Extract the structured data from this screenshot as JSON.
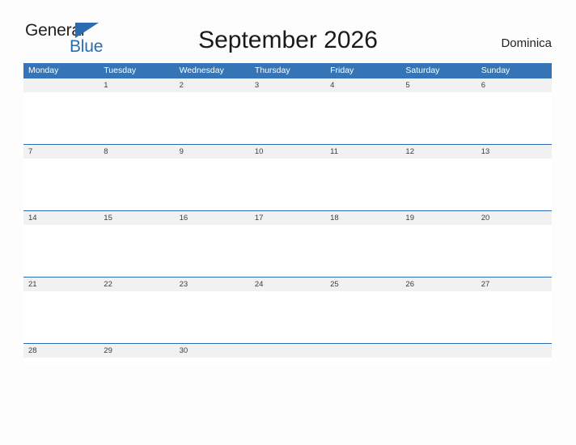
{
  "logo": {
    "word_one": "General",
    "word_two": "Blue",
    "triangle_icon": "triangle-icon",
    "colors": {
      "word_one": "#231f20",
      "word_two": "#2b6cb0",
      "triangle": "#2b6cb0"
    }
  },
  "header": {
    "title": "September 2026",
    "country": "Dominica"
  },
  "colors": {
    "header_blue": "#3575b5",
    "row_divider_blue": "#2b6cb0",
    "date_band_gray": "#f1f1f1",
    "page_background": "#fdfdfd",
    "weekday_text": "#ffffff",
    "date_text": "#3c3c3c"
  },
  "calendar": {
    "month": "September",
    "year": "2026",
    "weekday_headers": [
      "Monday",
      "Tuesday",
      "Wednesday",
      "Thursday",
      "Friday",
      "Saturday",
      "Sunday"
    ],
    "weeks": [
      [
        "",
        "1",
        "2",
        "3",
        "4",
        "5",
        "6"
      ],
      [
        "7",
        "8",
        "9",
        "10",
        "11",
        "12",
        "13"
      ],
      [
        "14",
        "15",
        "16",
        "17",
        "18",
        "19",
        "20"
      ],
      [
        "21",
        "22",
        "23",
        "24",
        "25",
        "26",
        "27"
      ],
      [
        "28",
        "29",
        "30",
        "",
        "",
        "",
        ""
      ]
    ]
  }
}
